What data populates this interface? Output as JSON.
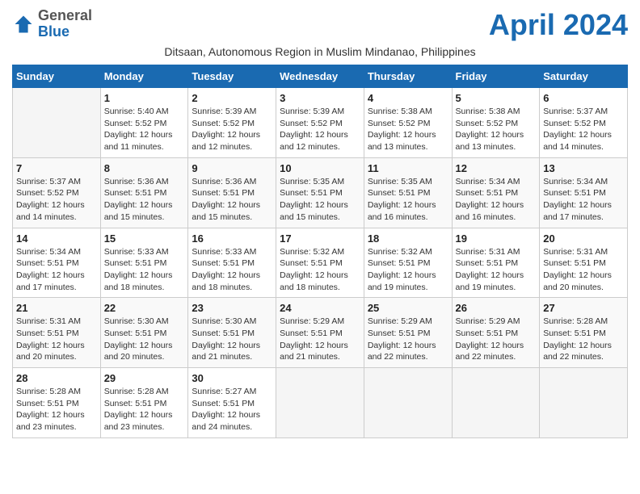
{
  "logo": {
    "general": "General",
    "blue": "Blue"
  },
  "title": "April 2024",
  "subtitle": "Ditsaan, Autonomous Region in Muslim Mindanao, Philippines",
  "days_of_week": [
    "Sunday",
    "Monday",
    "Tuesday",
    "Wednesday",
    "Thursday",
    "Friday",
    "Saturday"
  ],
  "weeks": [
    [
      {
        "day": "",
        "info": ""
      },
      {
        "day": "1",
        "info": "Sunrise: 5:40 AM\nSunset: 5:52 PM\nDaylight: 12 hours\nand 11 minutes."
      },
      {
        "day": "2",
        "info": "Sunrise: 5:39 AM\nSunset: 5:52 PM\nDaylight: 12 hours\nand 12 minutes."
      },
      {
        "day": "3",
        "info": "Sunrise: 5:39 AM\nSunset: 5:52 PM\nDaylight: 12 hours\nand 12 minutes."
      },
      {
        "day": "4",
        "info": "Sunrise: 5:38 AM\nSunset: 5:52 PM\nDaylight: 12 hours\nand 13 minutes."
      },
      {
        "day": "5",
        "info": "Sunrise: 5:38 AM\nSunset: 5:52 PM\nDaylight: 12 hours\nand 13 minutes."
      },
      {
        "day": "6",
        "info": "Sunrise: 5:37 AM\nSunset: 5:52 PM\nDaylight: 12 hours\nand 14 minutes."
      }
    ],
    [
      {
        "day": "7",
        "info": "Sunrise: 5:37 AM\nSunset: 5:52 PM\nDaylight: 12 hours\nand 14 minutes."
      },
      {
        "day": "8",
        "info": "Sunrise: 5:36 AM\nSunset: 5:51 PM\nDaylight: 12 hours\nand 15 minutes."
      },
      {
        "day": "9",
        "info": "Sunrise: 5:36 AM\nSunset: 5:51 PM\nDaylight: 12 hours\nand 15 minutes."
      },
      {
        "day": "10",
        "info": "Sunrise: 5:35 AM\nSunset: 5:51 PM\nDaylight: 12 hours\nand 15 minutes."
      },
      {
        "day": "11",
        "info": "Sunrise: 5:35 AM\nSunset: 5:51 PM\nDaylight: 12 hours\nand 16 minutes."
      },
      {
        "day": "12",
        "info": "Sunrise: 5:34 AM\nSunset: 5:51 PM\nDaylight: 12 hours\nand 16 minutes."
      },
      {
        "day": "13",
        "info": "Sunrise: 5:34 AM\nSunset: 5:51 PM\nDaylight: 12 hours\nand 17 minutes."
      }
    ],
    [
      {
        "day": "14",
        "info": "Sunrise: 5:34 AM\nSunset: 5:51 PM\nDaylight: 12 hours\nand 17 minutes."
      },
      {
        "day": "15",
        "info": "Sunrise: 5:33 AM\nSunset: 5:51 PM\nDaylight: 12 hours\nand 18 minutes."
      },
      {
        "day": "16",
        "info": "Sunrise: 5:33 AM\nSunset: 5:51 PM\nDaylight: 12 hours\nand 18 minutes."
      },
      {
        "day": "17",
        "info": "Sunrise: 5:32 AM\nSunset: 5:51 PM\nDaylight: 12 hours\nand 18 minutes."
      },
      {
        "day": "18",
        "info": "Sunrise: 5:32 AM\nSunset: 5:51 PM\nDaylight: 12 hours\nand 19 minutes."
      },
      {
        "day": "19",
        "info": "Sunrise: 5:31 AM\nSunset: 5:51 PM\nDaylight: 12 hours\nand 19 minutes."
      },
      {
        "day": "20",
        "info": "Sunrise: 5:31 AM\nSunset: 5:51 PM\nDaylight: 12 hours\nand 20 minutes."
      }
    ],
    [
      {
        "day": "21",
        "info": "Sunrise: 5:31 AM\nSunset: 5:51 PM\nDaylight: 12 hours\nand 20 minutes."
      },
      {
        "day": "22",
        "info": "Sunrise: 5:30 AM\nSunset: 5:51 PM\nDaylight: 12 hours\nand 20 minutes."
      },
      {
        "day": "23",
        "info": "Sunrise: 5:30 AM\nSunset: 5:51 PM\nDaylight: 12 hours\nand 21 minutes."
      },
      {
        "day": "24",
        "info": "Sunrise: 5:29 AM\nSunset: 5:51 PM\nDaylight: 12 hours\nand 21 minutes."
      },
      {
        "day": "25",
        "info": "Sunrise: 5:29 AM\nSunset: 5:51 PM\nDaylight: 12 hours\nand 22 minutes."
      },
      {
        "day": "26",
        "info": "Sunrise: 5:29 AM\nSunset: 5:51 PM\nDaylight: 12 hours\nand 22 minutes."
      },
      {
        "day": "27",
        "info": "Sunrise: 5:28 AM\nSunset: 5:51 PM\nDaylight: 12 hours\nand 22 minutes."
      }
    ],
    [
      {
        "day": "28",
        "info": "Sunrise: 5:28 AM\nSunset: 5:51 PM\nDaylight: 12 hours\nand 23 minutes."
      },
      {
        "day": "29",
        "info": "Sunrise: 5:28 AM\nSunset: 5:51 PM\nDaylight: 12 hours\nand 23 minutes."
      },
      {
        "day": "30",
        "info": "Sunrise: 5:27 AM\nSunset: 5:51 PM\nDaylight: 12 hours\nand 24 minutes."
      },
      {
        "day": "",
        "info": ""
      },
      {
        "day": "",
        "info": ""
      },
      {
        "day": "",
        "info": ""
      },
      {
        "day": "",
        "info": ""
      }
    ]
  ]
}
